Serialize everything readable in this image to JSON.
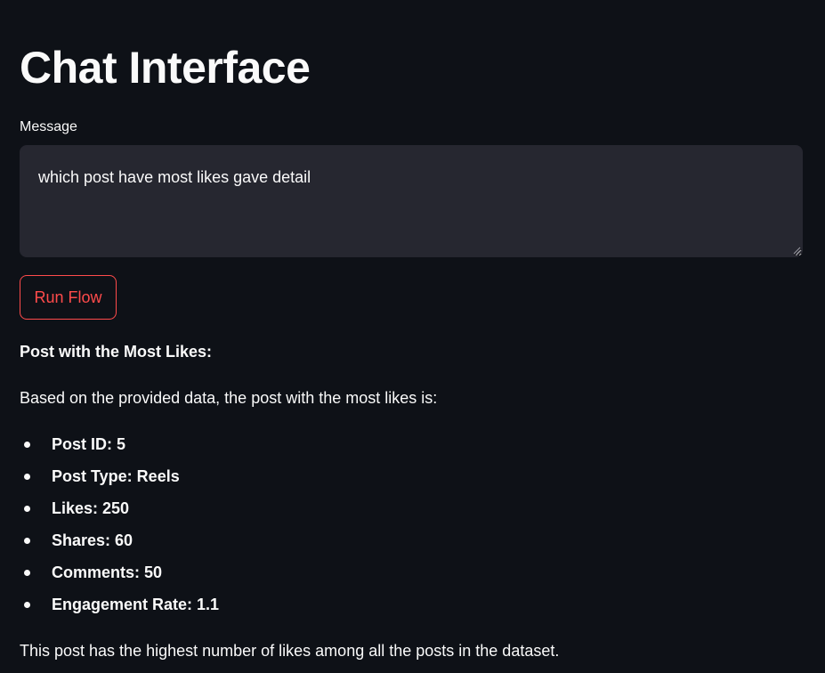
{
  "page": {
    "title": "Chat Interface"
  },
  "message": {
    "label": "Message",
    "value": "which post have most likes gave detail",
    "placeholder": ""
  },
  "run_button": {
    "label": "Run Flow"
  },
  "result": {
    "heading": "Post with the Most Likes:",
    "intro": "Based on the provided data, the post with the most likes is:",
    "details": [
      "Post ID: 5",
      "Post Type: Reels",
      "Likes: 250",
      "Shares: 60",
      "Comments: 50",
      "Engagement Rate: 1.1"
    ],
    "footer": "This post has the highest number of likes among all the posts in the dataset."
  },
  "colors": {
    "background": "#0e1117",
    "input_background": "#262730",
    "accent": "#ff4b4b",
    "text": "#fafafa"
  }
}
